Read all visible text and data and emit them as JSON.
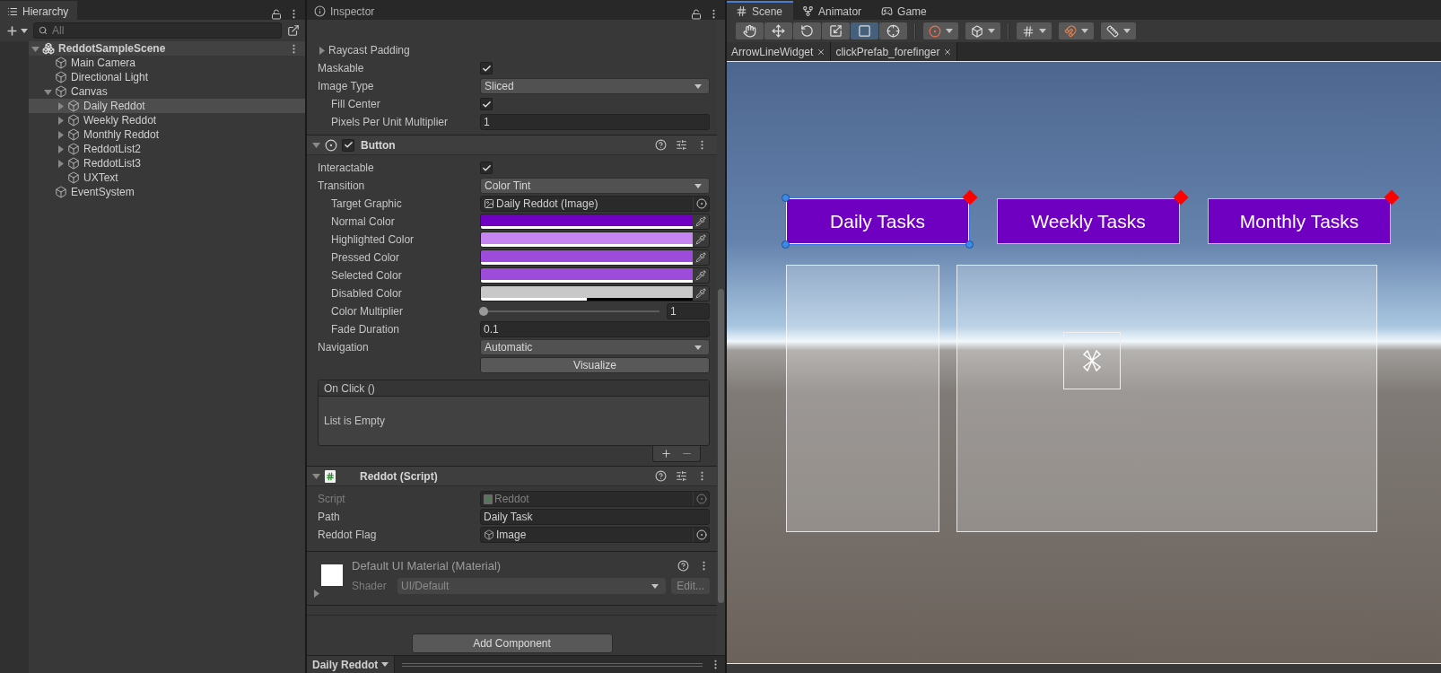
{
  "hierarchy": {
    "title": "Hierarchy",
    "search": {
      "placeholder": "All"
    },
    "tree": [
      {
        "name": "ReddotSampleScene",
        "kind": "scene",
        "expanded": true,
        "selected": false,
        "children": [
          {
            "name": "Main Camera",
            "kind": "object",
            "selected": false
          },
          {
            "name": "Directional Light",
            "kind": "object",
            "selected": false
          },
          {
            "name": "Canvas",
            "kind": "object",
            "expanded": true,
            "selected": false,
            "children": [
              {
                "name": "Daily Reddot",
                "kind": "object",
                "expanded": false,
                "selected": true
              },
              {
                "name": "Weekly Reddot",
                "kind": "object",
                "expanded": false,
                "selected": false
              },
              {
                "name": "Monthly Reddot",
                "kind": "object",
                "expanded": false,
                "selected": false
              },
              {
                "name": "ReddotList2",
                "kind": "object",
                "expanded": false,
                "selected": false
              },
              {
                "name": "ReddotList3",
                "kind": "object",
                "expanded": false,
                "selected": false
              },
              {
                "name": "UXText",
                "kind": "object",
                "selected": false
              }
            ]
          },
          {
            "name": "EventSystem",
            "kind": "object",
            "selected": false
          }
        ]
      }
    ]
  },
  "inspector": {
    "title": "Inspector",
    "image_fields": [
      {
        "kind": "foldout",
        "label": "Raycast Padding",
        "disabled": false
      },
      {
        "kind": "checkbox",
        "label": "Maskable",
        "checked": true,
        "disabled": false
      },
      {
        "kind": "dropdown",
        "label": "Image Type",
        "value": "Sliced",
        "disabled": false,
        "children": [
          {
            "kind": "checkbox",
            "label": "Fill Center",
            "checked": true,
            "disabled": false
          },
          {
            "kind": "number",
            "label": "Pixels Per Unit Multiplier",
            "value": "1",
            "disabled": false
          }
        ]
      }
    ],
    "button": {
      "title": "Button",
      "expanded": true,
      "enabled": true,
      "fields": [
        {
          "kind": "checkbox",
          "label": "Interactable",
          "checked": true,
          "disabled": false
        },
        {
          "kind": "dropdown",
          "label": "Transition",
          "value": "Color Tint",
          "disabled": false,
          "children": [
            {
              "kind": "image_ref",
              "label": "Target Graphic",
              "value": "Daily Reddot (Image)",
              "disabled": false
            },
            {
              "kind": "color",
              "label": "Normal Color",
              "color": "#6f00c2",
              "level": 1,
              "disabled": false
            },
            {
              "kind": "color",
              "label": "Highlighted Color",
              "color": "#c685f0",
              "level": 1,
              "disabled": false
            },
            {
              "kind": "color",
              "label": "Pressed Color",
              "color": "#9c4bdb",
              "level": 1,
              "disabled": false
            },
            {
              "kind": "color",
              "label": "Selected Color",
              "color": "#9c4bdb",
              "level": 1,
              "disabled": false
            },
            {
              "kind": "color",
              "label": "Disabled Color",
              "color": "#c8c8c8",
              "level": 0.5,
              "disabled": false
            },
            {
              "kind": "slider",
              "label": "Color Multiplier",
              "level": 0,
              "value": "1",
              "disabled": false
            },
            {
              "kind": "number",
              "label": "Fade Duration",
              "value": "0.1",
              "disabled": false
            }
          ]
        },
        {
          "kind": "dropdown",
          "label": "Navigation",
          "value": "Automatic",
          "disabled": false
        },
        {
          "kind": "button",
          "label": "Visualize",
          "disabled": false
        }
      ],
      "event": {
        "title": "On Click ()",
        "empty_text": "List is Empty"
      }
    },
    "script": {
      "title": "Reddot (Script)",
      "expanded": true,
      "fields": [
        {
          "kind": "script_ref",
          "label": "Script",
          "value": "Reddot",
          "disabled": true
        },
        {
          "kind": "text",
          "label": "Path",
          "value": "Daily Task",
          "disabled": false
        },
        {
          "kind": "object_ref",
          "label": "Reddot Flag",
          "value": "Image",
          "disabled": false
        }
      ]
    },
    "material": {
      "title": "Default UI Material (Material)",
      "expanded": false,
      "shader_label": "Shader",
      "shader": "UI/Default",
      "edit_label": "Edit..."
    },
    "add_component": "Add Component",
    "footer": "Daily Reddot"
  },
  "scene": {
    "tabs": [
      {
        "label": "Scene",
        "kind": "scene",
        "selected": true
      },
      {
        "label": "Animator",
        "kind": "animator",
        "selected": false
      },
      {
        "label": "Game",
        "kind": "game",
        "selected": false
      }
    ],
    "tools": [
      {
        "kind": "hand",
        "selected": false
      },
      {
        "kind": "move",
        "selected": false
      },
      {
        "kind": "rotate",
        "selected": false
      },
      {
        "kind": "scale",
        "selected": false
      },
      {
        "kind": "rect",
        "selected": true
      },
      {
        "kind": "transform",
        "selected": false
      }
    ],
    "file_tabs": [
      {
        "label": "ArrowLineWidget"
      },
      {
        "label": "clickPrefab_forefinger"
      }
    ],
    "buttons": [
      {
        "label": "Daily Tasks",
        "selected": true,
        "badge": true
      },
      {
        "label": "Weekly Tasks",
        "selected": false,
        "badge": true
      },
      {
        "label": "Monthly Tasks",
        "selected": false,
        "badge": true
      }
    ]
  }
}
